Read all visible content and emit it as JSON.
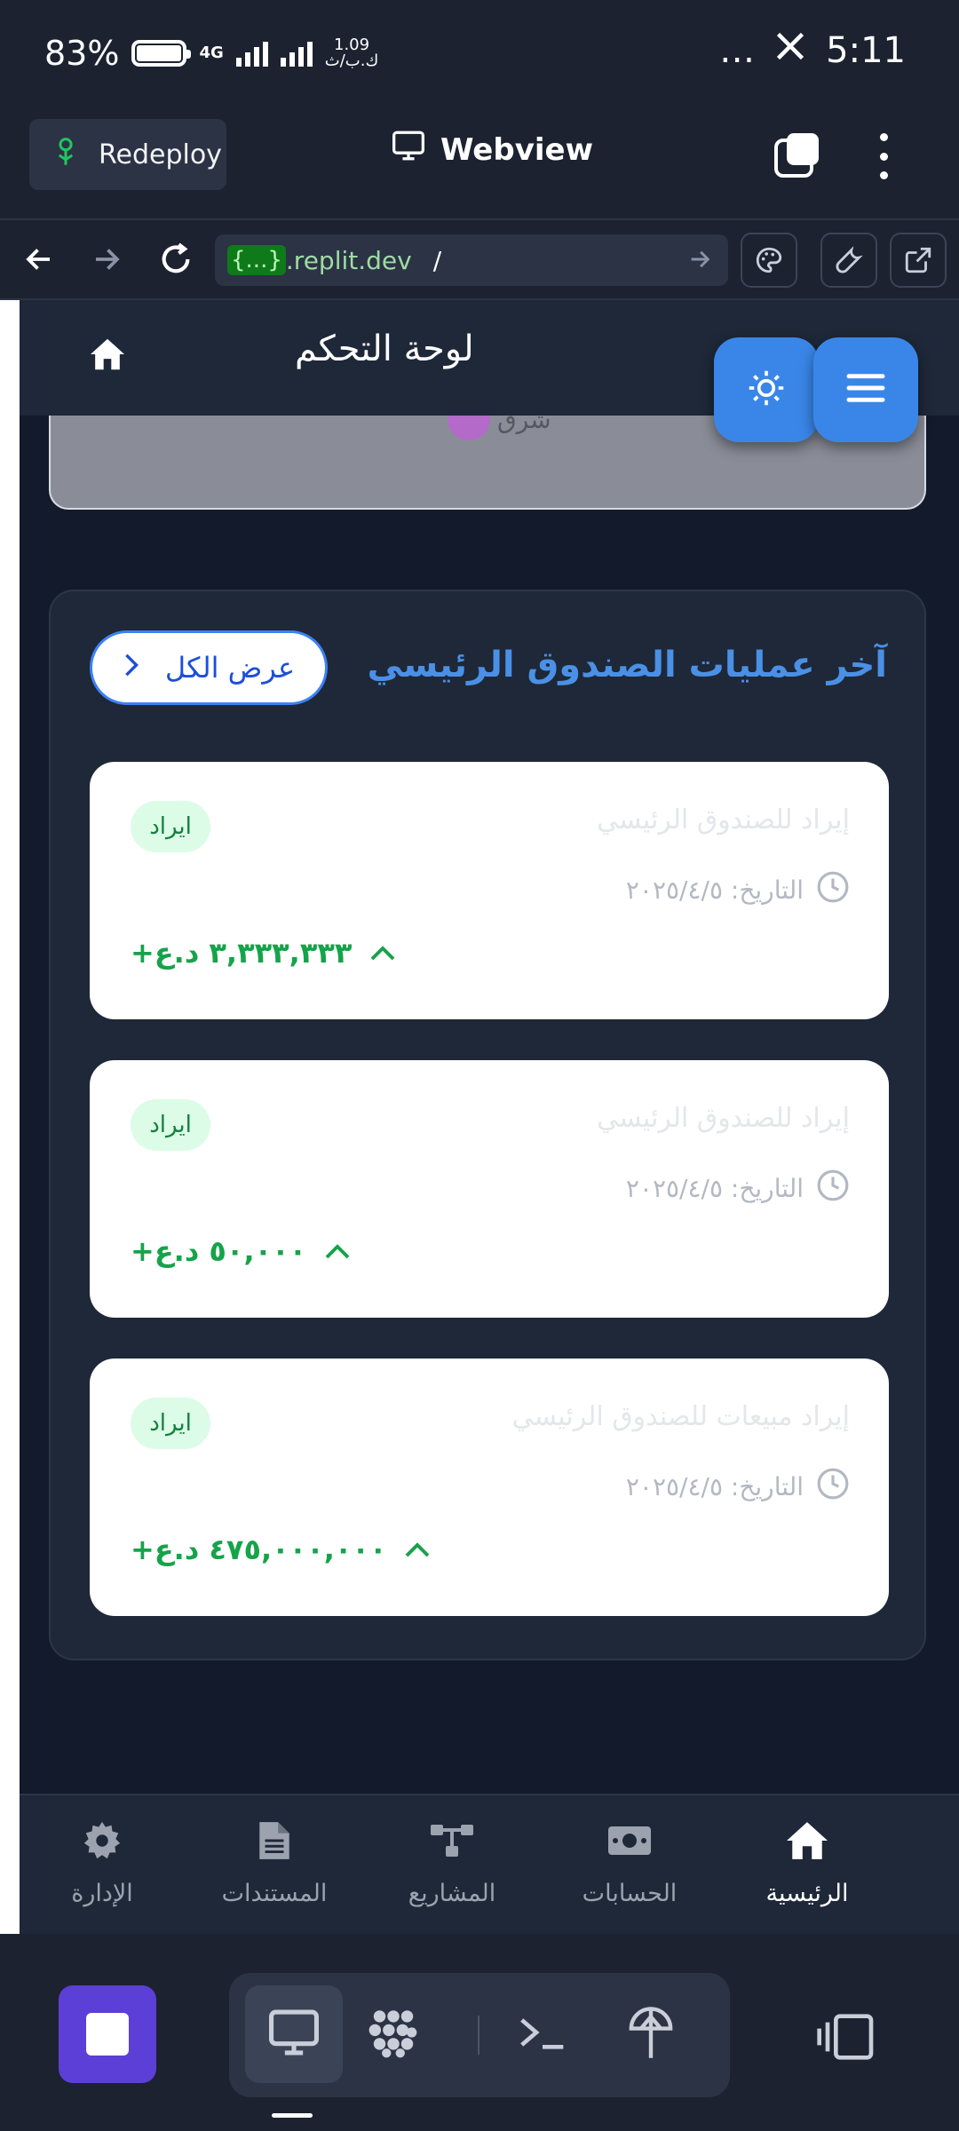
{
  "status_bar": {
    "battery": "83%",
    "net_type": "4G",
    "speed_value": "1.09",
    "speed_unit": "ك.ب/ث",
    "more": "…",
    "time": "5:11"
  },
  "replit": {
    "redeploy_label": "Redeploy",
    "webview_label": "Webview",
    "url_badge": "{...}",
    "url_host": ".replit.dev",
    "url_path": "/"
  },
  "app": {
    "header_title": "لوحة التحكم",
    "prev_card_text": "شرق",
    "panel_title": "آخر عمليات الصندوق الرئيسي",
    "view_all_label": "عرض الكل",
    "transactions": [
      {
        "description": "إيراد للصندوق الرئيسي",
        "date": "التاريخ: ٢٠٢٥/٤/٥",
        "type": "ايراد",
        "amount": "+٣,٣٣٣,٣٣٣ د.ع"
      },
      {
        "description": "إيراد للصندوق الرئيسي",
        "date": "التاريخ: ٢٠٢٥/٤/٥",
        "type": "ايراد",
        "amount": "+٥٠,٠٠٠ د.ع"
      },
      {
        "description": "إيراد مبيعات للصندوق الرئيسي",
        "date": "التاريخ: ٢٠٢٥/٤/٥",
        "type": "ايراد",
        "amount": "+٤٧٥,٠٠٠,٠٠٠ د.ع"
      }
    ],
    "bottom_nav": [
      {
        "label": "الرئيسية",
        "icon": "home-icon",
        "active": true
      },
      {
        "label": "الحسابات",
        "icon": "money-icon",
        "active": false
      },
      {
        "label": "المشاريع",
        "icon": "sitemap-icon",
        "active": false
      },
      {
        "label": "المستندات",
        "icon": "document-icon",
        "active": false
      },
      {
        "label": "الإدارة",
        "icon": "gear-icon",
        "active": false
      }
    ]
  },
  "colors": {
    "accent_blue": "#3a86e8",
    "income_green": "#16a34a",
    "badge_green_bg": "#dcfce7",
    "panel_bg": "#1e2838",
    "stop_purple": "#5b3fd6"
  }
}
